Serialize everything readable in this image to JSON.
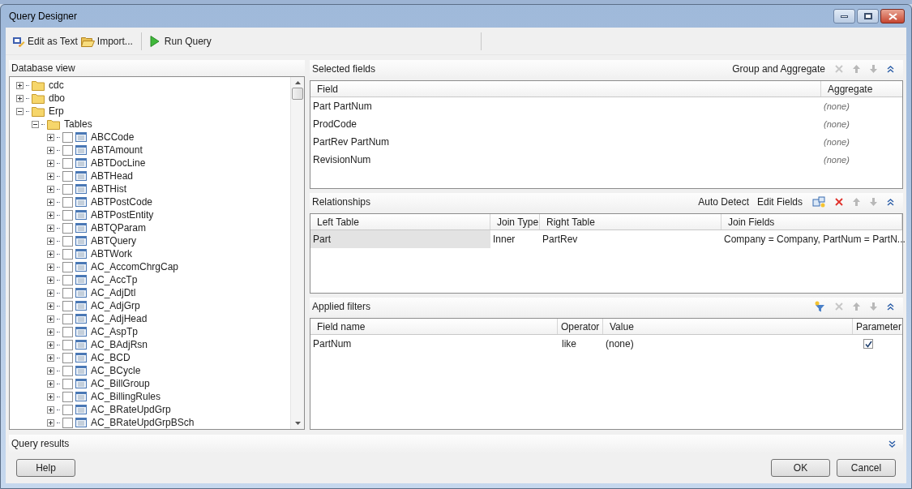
{
  "window": {
    "title": "Query Designer"
  },
  "toolbar": [
    {
      "label": "Edit as Text",
      "kind": "edit"
    },
    {
      "label": "Import...",
      "kind": "import"
    },
    {
      "label": "Run Query",
      "kind": "run"
    }
  ],
  "database_view": {
    "title": "Database view",
    "tree": [
      {
        "label": "cdc",
        "kind": "folder",
        "expanded": false
      },
      {
        "label": "dbo",
        "kind": "folder",
        "expanded": false
      },
      {
        "label": "Erp",
        "kind": "folder",
        "expanded": true,
        "children": [
          {
            "label": "Tables",
            "kind": "folder",
            "expanded": true,
            "children": [
              {
                "label": "ABCCode",
                "kind": "table",
                "expanded": false,
                "checked": false
              },
              {
                "label": "ABTAmount",
                "kind": "table",
                "expanded": false,
                "checked": false
              },
              {
                "label": "ABTDocLine",
                "kind": "table",
                "expanded": false,
                "checked": false
              },
              {
                "label": "ABTHead",
                "kind": "table",
                "expanded": false,
                "checked": false
              },
              {
                "label": "ABTHist",
                "kind": "table",
                "expanded": false,
                "checked": false
              },
              {
                "label": "ABTPostCode",
                "kind": "table",
                "expanded": false,
                "checked": false
              },
              {
                "label": "ABTPostEntity",
                "kind": "table",
                "expanded": false,
                "checked": false
              },
              {
                "label": "ABTQParam",
                "kind": "table",
                "expanded": false,
                "checked": false
              },
              {
                "label": "ABTQuery",
                "kind": "table",
                "expanded": false,
                "checked": false
              },
              {
                "label": "ABTWork",
                "kind": "table",
                "expanded": false,
                "checked": false
              },
              {
                "label": "AC_AccomChrgCap",
                "kind": "table",
                "expanded": false,
                "checked": false
              },
              {
                "label": "AC_AccTp",
                "kind": "table",
                "expanded": false,
                "checked": false
              },
              {
                "label": "AC_AdjDtl",
                "kind": "table",
                "expanded": false,
                "checked": false
              },
              {
                "label": "AC_AdjGrp",
                "kind": "table",
                "expanded": false,
                "checked": false
              },
              {
                "label": "AC_AdjHead",
                "kind": "table",
                "expanded": false,
                "checked": false
              },
              {
                "label": "AC_AspTp",
                "kind": "table",
                "expanded": false,
                "checked": false
              },
              {
                "label": "AC_BAdjRsn",
                "kind": "table",
                "expanded": false,
                "checked": false
              },
              {
                "label": "AC_BCD",
                "kind": "table",
                "expanded": false,
                "checked": false
              },
              {
                "label": "AC_BCycle",
                "kind": "table",
                "expanded": false,
                "checked": false
              },
              {
                "label": "AC_BillGroup",
                "kind": "table",
                "expanded": false,
                "checked": false
              },
              {
                "label": "AC_BillingRules",
                "kind": "table",
                "expanded": false,
                "checked": false
              },
              {
                "label": "AC_BRateUpdGrp",
                "kind": "table",
                "expanded": false,
                "checked": false
              },
              {
                "label": "AC_BRateUpdGrpBSch",
                "kind": "table",
                "expanded": false,
                "checked": false
              }
            ]
          }
        ]
      }
    ]
  },
  "selected_fields": {
    "title": "Selected fields",
    "action": "Group and Aggregate",
    "columns": [
      "Field",
      "Aggregate"
    ],
    "rows": [
      {
        "field": "Part PartNum",
        "aggregate": "(none)"
      },
      {
        "field": "ProdCode",
        "aggregate": "(none)"
      },
      {
        "field": "PartRev PartNum",
        "aggregate": "(none)"
      },
      {
        "field": "RevisionNum",
        "aggregate": "(none)"
      }
    ]
  },
  "relationships": {
    "title": "Relationships",
    "actions": [
      "Auto Detect",
      "Edit Fields"
    ],
    "columns": [
      "Left Table",
      "Join Type",
      "Right Table",
      "Join Fields"
    ],
    "rows": [
      {
        "cells": [
          "Part",
          "Inner",
          "PartRev",
          "Company = Company, PartNum = PartN..."
        ],
        "selected": true
      }
    ]
  },
  "applied_filters": {
    "title": "Applied filters",
    "columns": [
      "Field name",
      "Operator",
      "Value",
      "Parameter"
    ],
    "rows": [
      {
        "field_name": "PartNum",
        "operator": "like",
        "value": "(none)",
        "parameter": true
      }
    ]
  },
  "query_results": {
    "title": "Query results",
    "expanded": false
  },
  "buttons": [
    {
      "label": "Help"
    },
    {
      "label": "OK"
    },
    {
      "label": "Cancel"
    }
  ]
}
